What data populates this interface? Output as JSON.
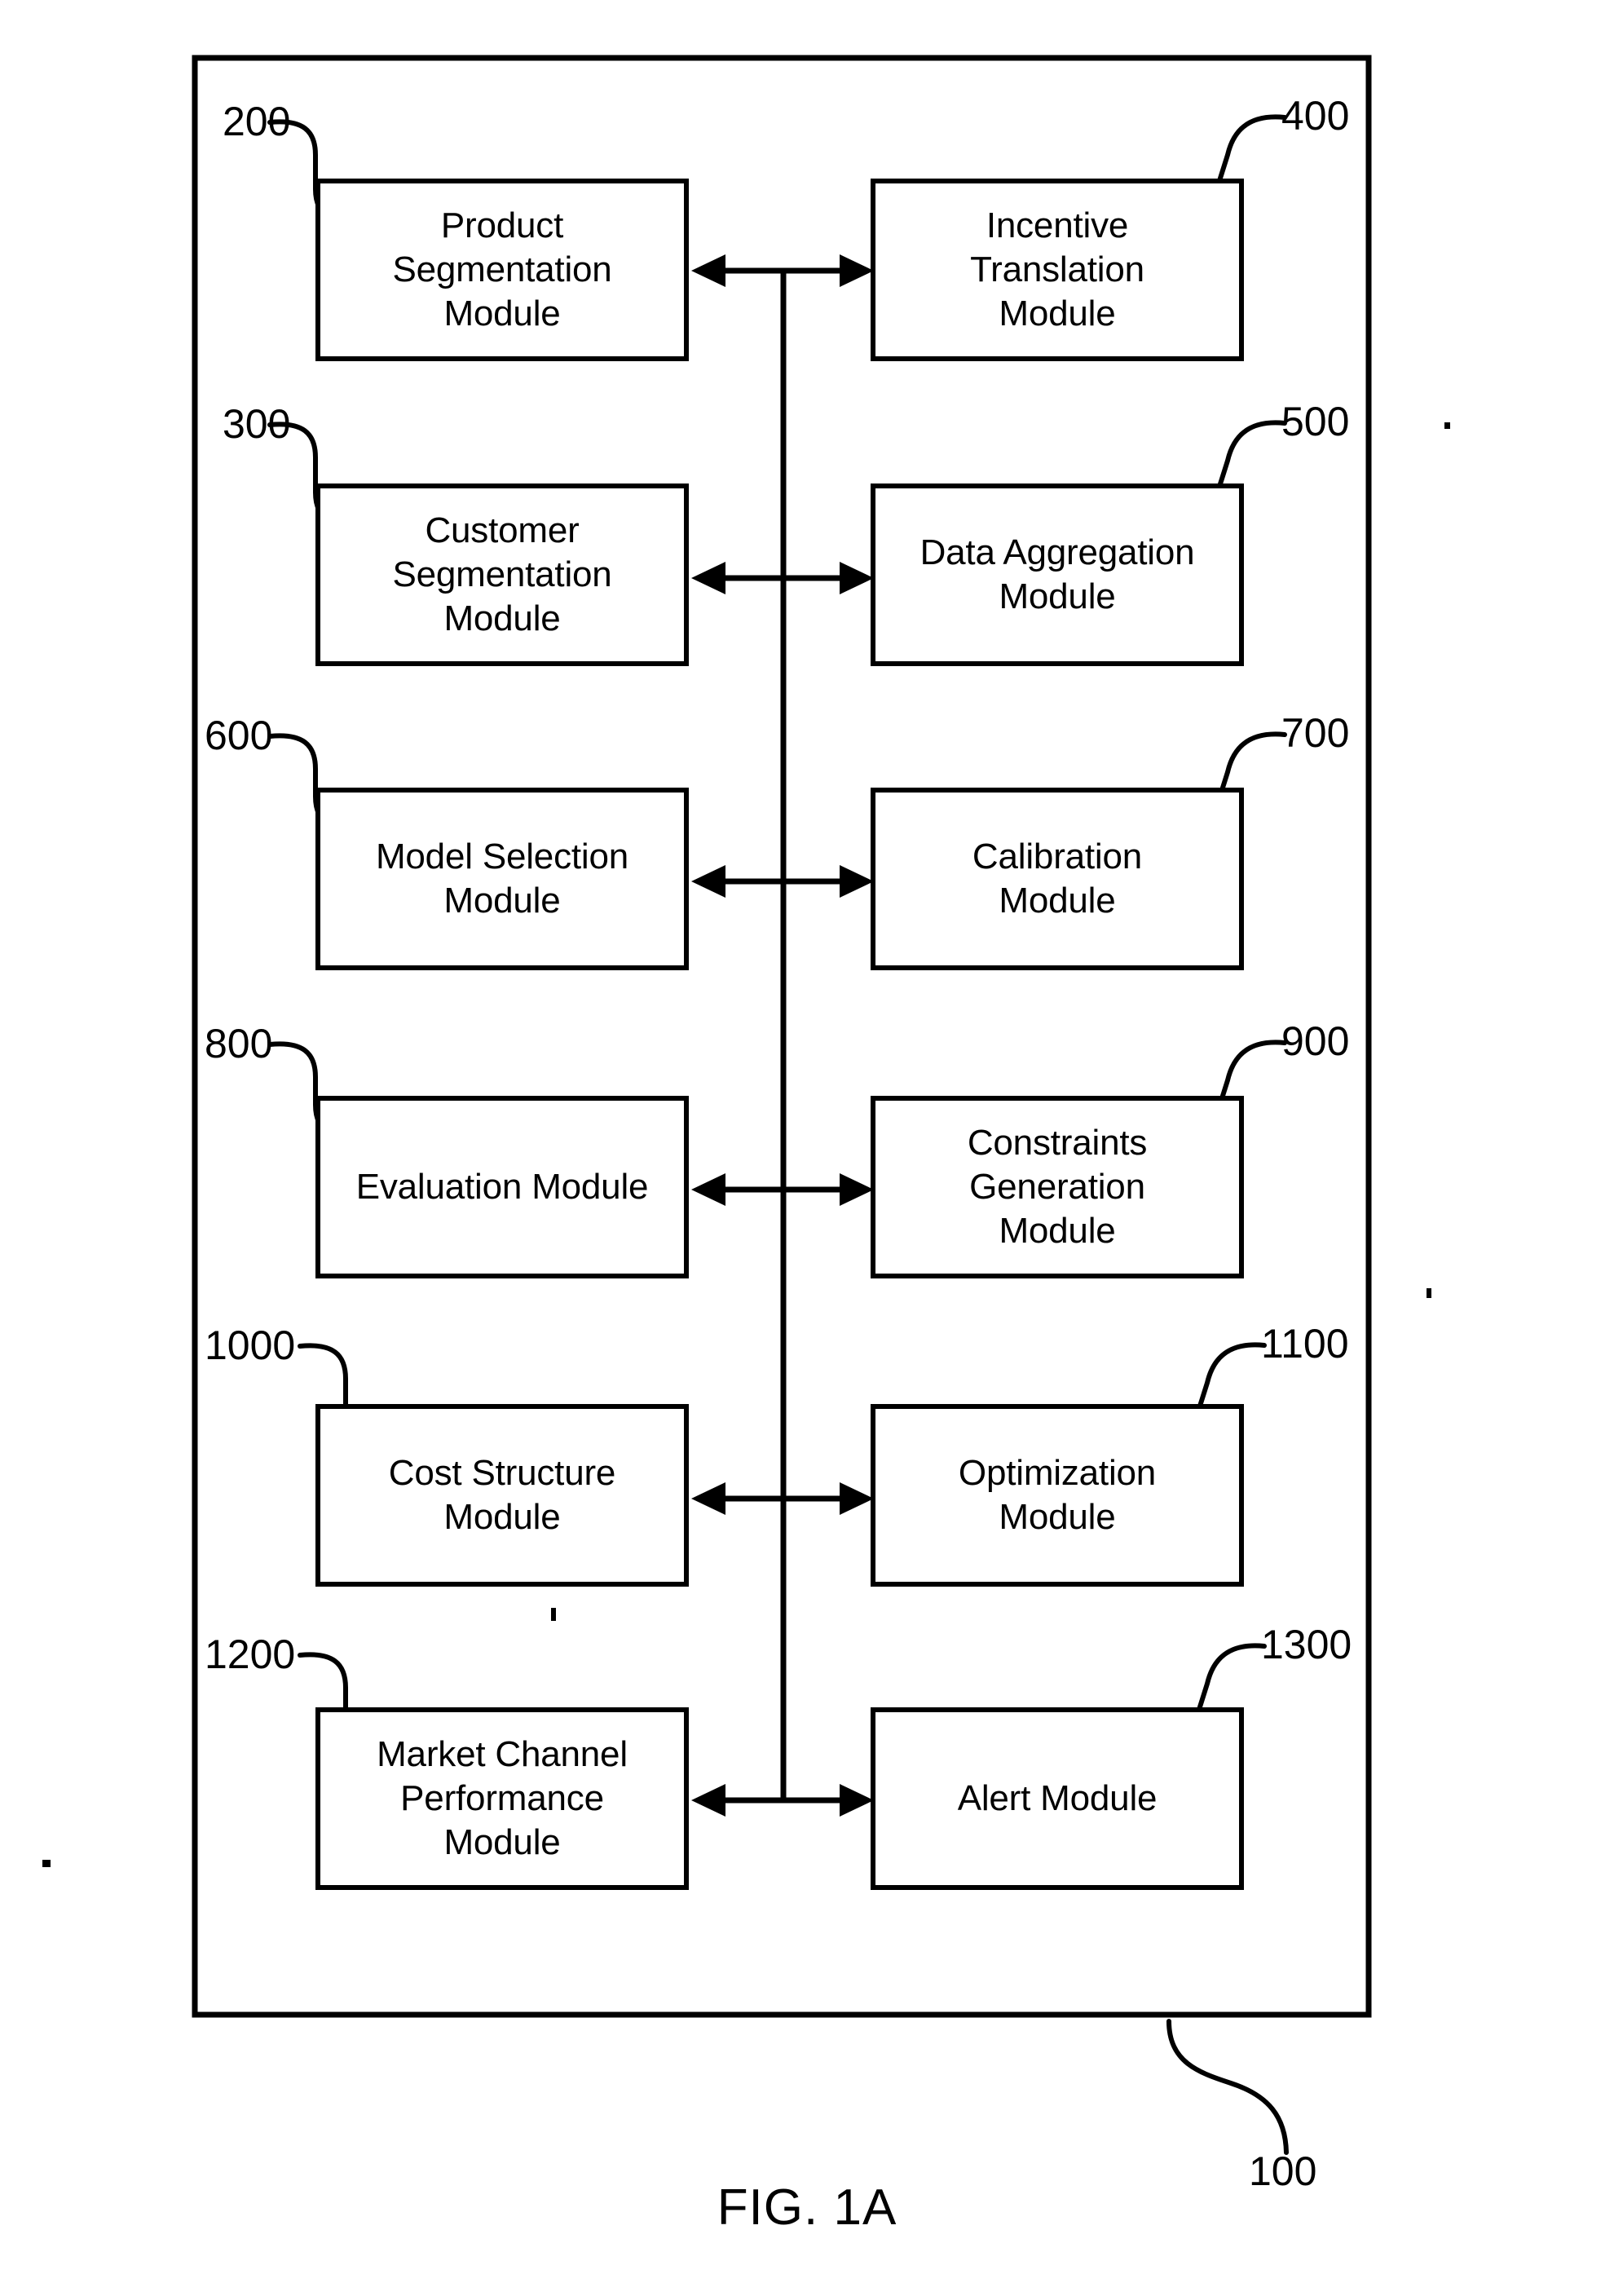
{
  "figure": {
    "caption": "FIG. 1A",
    "system_ref": "100",
    "system_ref_name": "system-boundary"
  },
  "modules": [
    {
      "ref": "200",
      "label": "Product\nSegmentation\nModule",
      "side": "left",
      "row": 1,
      "name": "product-segmentation-module"
    },
    {
      "ref": "400",
      "label": "Incentive\nTranslation\nModule",
      "side": "right",
      "row": 1,
      "name": "incentive-translation-module"
    },
    {
      "ref": "300",
      "label": "Customer\nSegmentation\nModule",
      "side": "left",
      "row": 2,
      "name": "customer-segmentation-module"
    },
    {
      "ref": "500",
      "label": "Data Aggregation\nModule",
      "side": "right",
      "row": 2,
      "name": "data-aggregation-module"
    },
    {
      "ref": "600",
      "label": "Model Selection\nModule",
      "side": "left",
      "row": 3,
      "name": "model-selection-module"
    },
    {
      "ref": "700",
      "label": "Calibration\nModule",
      "side": "right",
      "row": 3,
      "name": "calibration-module"
    },
    {
      "ref": "800",
      "label": "Evaluation Module",
      "side": "left",
      "row": 4,
      "name": "evaluation-module"
    },
    {
      "ref": "900",
      "label": "Constraints\nGeneration\nModule",
      "side": "right",
      "row": 4,
      "name": "constraints-generation-module"
    },
    {
      "ref": "1000",
      "label": "Cost Structure\nModule",
      "side": "left",
      "row": 5,
      "name": "cost-structure-module"
    },
    {
      "ref": "1100",
      "label": "Optimization\nModule",
      "side": "right",
      "row": 5,
      "name": "optimization-module"
    },
    {
      "ref": "1200",
      "label": "Market Channel\nPerformance\nModule",
      "side": "left",
      "row": 6,
      "name": "market-channel-performance-module"
    },
    {
      "ref": "1300",
      "label": "Alert Module",
      "side": "right",
      "row": 6,
      "name": "alert-module"
    }
  ],
  "connectors": {
    "type": "bidirectional-arrow",
    "count": 6,
    "bus_description": "vertical bus line joining all six bidirectional connectors"
  },
  "colors": {
    "line": "#000000",
    "background": "#ffffff",
    "text": "#000000"
  }
}
